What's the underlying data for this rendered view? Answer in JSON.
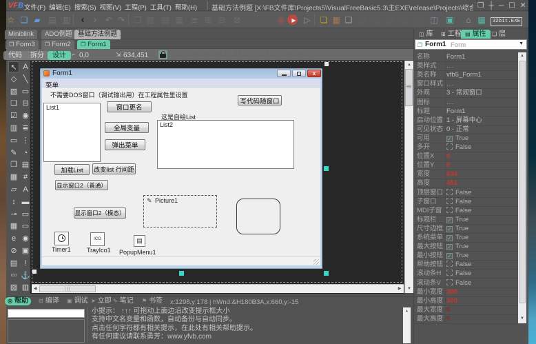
{
  "window": {
    "logo": "VFB",
    "title_path": "基础方法例题 [X:\\FB文件库\\Projects5\\VisualFreeBasic5.3\\主EXE\\release\\Projects\\综合例题\\基础方法例题\\基础...",
    "exe_badge": "32bit.EXE"
  },
  "menubar": {
    "items": [
      "文件(F)",
      "编辑(E)",
      "搜索(S)",
      "视图(V)",
      "工程(P)",
      "工具(T)",
      "帮助(H)"
    ]
  },
  "toolbar": {
    "icons": [
      {
        "name": "favorites-star-icon",
        "glyph": "☆",
        "color": "#cfa43b"
      },
      {
        "name": "new-project-icon",
        "glyph": "❏",
        "color": "#69a7e3"
      },
      {
        "name": "open-folder-icon",
        "glyph": "▰",
        "color": "#5e9ad8"
      },
      {
        "name": "save-icon",
        "glyph": "▤",
        "color": "#757575"
      },
      {
        "name": "save-all-icon",
        "glyph": "▥",
        "color": "#757575"
      },
      {
        "name": "back-icon",
        "glyph": "‹",
        "color": "#262626"
      },
      {
        "name": "forward-icon",
        "glyph": "›",
        "color": "#787878"
      },
      {
        "name": "undo-icon",
        "glyph": "↶",
        "color": "#787878"
      },
      {
        "name": "redo-icon",
        "glyph": "↷",
        "color": "#787878"
      },
      {
        "name": "copy-icon",
        "glyph": "❐",
        "color": "#6b6b6b"
      },
      {
        "name": "paste-icon",
        "glyph": "▧",
        "color": "#6b6b6b"
      },
      {
        "name": "indent-icon",
        "glyph": "▤",
        "color": "#6b6b6b"
      },
      {
        "name": "outdent-icon",
        "glyph": "▦",
        "color": "#6b6b6b"
      },
      {
        "name": "list-icon",
        "glyph": "≣",
        "color": "#6b6b6b"
      },
      {
        "name": "add-icon",
        "glyph": "⊞",
        "color": "#6b6b6b"
      },
      {
        "name": "remove-icon",
        "glyph": "⊟",
        "color": "#6b6b6b"
      },
      {
        "name": "delete-icon",
        "glyph": "⊠",
        "color": "#6b6b6b"
      },
      {
        "name": "debug-target-icon",
        "glyph": "◎",
        "color": "#c0504d"
      },
      {
        "name": "run-icon",
        "glyph": "▶",
        "color": "#f3e9e7"
      },
      {
        "name": "step-icon",
        "glyph": "▷",
        "color": "#8f8f8f"
      },
      {
        "name": "layers-icon",
        "glyph": "❏",
        "color": "#c9a227"
      },
      {
        "name": "image-icon",
        "glyph": "▦",
        "color": "#a87850"
      },
      {
        "name": "window-icon",
        "glyph": "❑",
        "color": "#a0a0a0"
      },
      {
        "name": "tool1-icon",
        "glyph": "□",
        "color": "#646464"
      },
      {
        "name": "tool2-icon",
        "glyph": "□",
        "color": "#646464"
      },
      {
        "name": "tool3-icon",
        "glyph": "□",
        "color": "#646464"
      },
      {
        "name": "tool4-icon",
        "glyph": "□",
        "color": "#646464"
      },
      {
        "name": "tool5-icon",
        "glyph": "□",
        "color": "#646464"
      },
      {
        "name": "panel-icon",
        "glyph": "◫",
        "color": "#7f8fa0"
      },
      {
        "name": "form-teal-icon",
        "glyph": "▣",
        "color": "#58b8a8"
      },
      {
        "name": "home-icon",
        "glyph": "⌂",
        "color": "#a0a0a0"
      },
      {
        "name": "grid-teal-icon",
        "glyph": "▦",
        "color": "#58b8a8"
      }
    ]
  },
  "project_tabs": {
    "items": [
      {
        "label": "Miniblink",
        "active": false
      },
      {
        "label": "ADO例题",
        "active": false
      },
      {
        "label": "基础方法例题",
        "active": true
      }
    ]
  },
  "form_tabs": {
    "items": [
      {
        "label": "Form3",
        "active": false
      },
      {
        "label": "Form2",
        "active": false
      },
      {
        "label": "Form1",
        "active": true
      }
    ]
  },
  "design_bar": {
    "buttons": [
      {
        "label": "代码",
        "active": false
      },
      {
        "label": "拆分",
        "active": false
      },
      {
        "label": "设计",
        "active": true
      }
    ],
    "pos": "0,0",
    "size": "634,451"
  },
  "toolbox": {
    "items": [
      {
        "name": "cursor-tool-icon",
        "glyph": "↖",
        "selected": true
      },
      {
        "name": "label-tool-icon",
        "glyph": "A"
      },
      {
        "name": "shape-tool-icon",
        "glyph": "◇"
      },
      {
        "name": "line-tool-icon",
        "glyph": "╲"
      },
      {
        "name": "image-tool-icon",
        "glyph": "▧"
      },
      {
        "name": "button-tool-icon",
        "glyph": "▭"
      },
      {
        "name": "frame-tool-icon",
        "glyph": "❏"
      },
      {
        "name": "combobox-tool-icon",
        "glyph": "⊟"
      },
      {
        "name": "checkbox-tool-icon",
        "glyph": "☑"
      },
      {
        "name": "radio-tool-icon",
        "glyph": "◉"
      },
      {
        "name": "listview-tool-icon",
        "glyph": "▥"
      },
      {
        "name": "listbox-tool-icon",
        "glyph": "≣"
      },
      {
        "name": "textbox-tool-icon",
        "glyph": "▭"
      },
      {
        "name": "slider-tool-icon",
        "glyph": "⋮"
      },
      {
        "name": "pen-tool-icon",
        "glyph": "✎"
      },
      {
        "name": "timer-tool-icon",
        "glyph": "◔"
      },
      {
        "name": "window-tool-icon",
        "glyph": "❐"
      },
      {
        "name": "document-tool-icon",
        "glyph": "▤"
      },
      {
        "name": "grid-tool-icon",
        "glyph": "▦"
      },
      {
        "name": "chart-tool-icon",
        "glyph": "#"
      },
      {
        "name": "folder-tool-icon",
        "glyph": "▱"
      },
      {
        "name": "richtext-tool-icon",
        "glyph": "A"
      },
      {
        "name": "updown-tool-icon",
        "glyph": "↕"
      },
      {
        "name": "progress-tool-icon",
        "glyph": "▬"
      },
      {
        "name": "key-tool-icon",
        "glyph": "⊸"
      },
      {
        "name": "datepicker-tool-icon",
        "glyph": "▭"
      },
      {
        "name": "calendar-tool-icon",
        "glyph": "▦"
      },
      {
        "name": "toggle-tool-icon",
        "glyph": "▭"
      },
      {
        "name": "ie-tool-icon",
        "glyph": "e"
      },
      {
        "name": "chrome-tool-icon",
        "glyph": "◉"
      },
      {
        "name": "ellipse-tool-icon",
        "glyph": "⊘"
      },
      {
        "name": "picturebox-tool-icon",
        "glyph": "▣"
      },
      {
        "name": "database-tool-icon",
        "glyph": "▤"
      },
      {
        "name": "exclaim-tool-icon",
        "glyph": "!"
      },
      {
        "name": "ico-tool-icon",
        "glyph": "ICO"
      },
      {
        "name": "anchor-tool-icon",
        "glyph": "⚓"
      },
      {
        "name": "misc1-tool-icon",
        "glyph": "▨"
      },
      {
        "name": "misc2-tool-icon",
        "glyph": "▥"
      }
    ]
  },
  "designer": {
    "form": {
      "title": "Form1",
      "menu_label": "菜单",
      "note_label": "不需要DOS窗口（调试输出用）在工程属性里设置",
      "list1_item": "List1",
      "list2_item": "List2",
      "selfdraw_label": "这是自绘List",
      "buttons": {
        "rename": "窗口更名",
        "global": "全局变量",
        "popup": "弹出菜单",
        "write_code": "写代码随窗口",
        "load_list": "加载List",
        "line_spacing": "改变list 行间距",
        "show_normal": "显示窗口2（普通）",
        "show_modal": "显示窗口2（模态）"
      },
      "picture_label": "Picture1",
      "timer_label": "Timer1",
      "trayicon_label": "TrayIco1",
      "popupmenu_label": "PopupMenu1"
    }
  },
  "properties": {
    "tabs": [
      {
        "label": "库",
        "active": false
      },
      {
        "label": "工程",
        "active": false
      },
      {
        "label": "属性",
        "active": true
      },
      {
        "label": "层",
        "active": false
      }
    ],
    "selector": {
      "name": "Form1",
      "type": "Form"
    },
    "rows": [
      {
        "label": "名称",
        "value": "Form1",
        "kind": "text"
      },
      {
        "label": "类样式",
        "value": "....",
        "kind": "dots"
      },
      {
        "label": "类名称",
        "value": "vfb5_Form1",
        "kind": "text"
      },
      {
        "label": "窗口样式",
        "value": "....",
        "kind": "dots"
      },
      {
        "label": "外观",
        "value": "3 - 常规窗口",
        "kind": "text"
      },
      {
        "label": "图标",
        "value": "....",
        "kind": "dots"
      },
      {
        "label": "标题",
        "value": "Form1",
        "kind": "text"
      },
      {
        "label": "启动位置",
        "value": "1 - 屏幕中心",
        "kind": "text"
      },
      {
        "label": "可见状态",
        "value": "0 - 正常",
        "kind": "text"
      },
      {
        "label": "可用",
        "value": "True",
        "kind": "check-true"
      },
      {
        "label": "多开",
        "value": "False",
        "kind": "check-false"
      },
      {
        "label": "位置X",
        "value": "0",
        "kind": "red"
      },
      {
        "label": "位置Y",
        "value": "0",
        "kind": "red"
      },
      {
        "label": "宽度",
        "value": "634",
        "kind": "red"
      },
      {
        "label": "高度",
        "value": "451",
        "kind": "red"
      },
      {
        "label": "顶层窗口",
        "value": "False",
        "kind": "check-false"
      },
      {
        "label": "子窗口",
        "value": "False",
        "kind": "check-false"
      },
      {
        "label": "MDI子窗",
        "value": "False",
        "kind": "check-false"
      },
      {
        "label": "标题栏",
        "value": "True",
        "kind": "check-true"
      },
      {
        "label": "尺寸边框",
        "value": "True",
        "kind": "check-true"
      },
      {
        "label": "系统菜单",
        "value": "True",
        "kind": "check-true"
      },
      {
        "label": "最大按钮",
        "value": "True",
        "kind": "check-true"
      },
      {
        "label": "最小按钮",
        "value": "True",
        "kind": "check-true"
      },
      {
        "label": "帮助按钮",
        "value": "False",
        "kind": "check-false"
      },
      {
        "label": "滚动条H",
        "value": "False",
        "kind": "check-false"
      },
      {
        "label": "滚动条V",
        "value": "False",
        "kind": "check-false"
      },
      {
        "label": "最小宽度",
        "value": "300",
        "kind": "red"
      },
      {
        "label": "最小高度",
        "value": "300",
        "kind": "red"
      },
      {
        "label": "最大宽度",
        "value": "0",
        "kind": "darkred"
      },
      {
        "label": "最大高度",
        "value": "0",
        "kind": "darkred"
      }
    ]
  },
  "status_bar": {
    "tabs": [
      {
        "label": "帮助",
        "icon": "◎",
        "active": true
      },
      {
        "label": "编译",
        "icon": "⊟",
        "active": false
      },
      {
        "label": "调试",
        "icon": "▣",
        "active": false
      },
      {
        "label": "立即",
        "icon": "➤",
        "active": false
      },
      {
        "label": "笔记",
        "icon": "✎",
        "active": false
      },
      {
        "label": "书签",
        "icon": "⚑",
        "active": false
      }
    ],
    "position_text": "x:1298,y:178 | hWnd:&H180B3A,x:660,y:-15"
  },
  "help_panel": {
    "lines": [
      "小提示： ↑↑↑ 可拖动上面边沿改变提示框大小",
      "支持中文名变量和函数，自动备份与自动同步。",
      "点击任何字符都有相关提示，在此处有相关帮助提示。",
      "有任何建议请联系勇芳：www.yfvb.com"
    ]
  }
}
